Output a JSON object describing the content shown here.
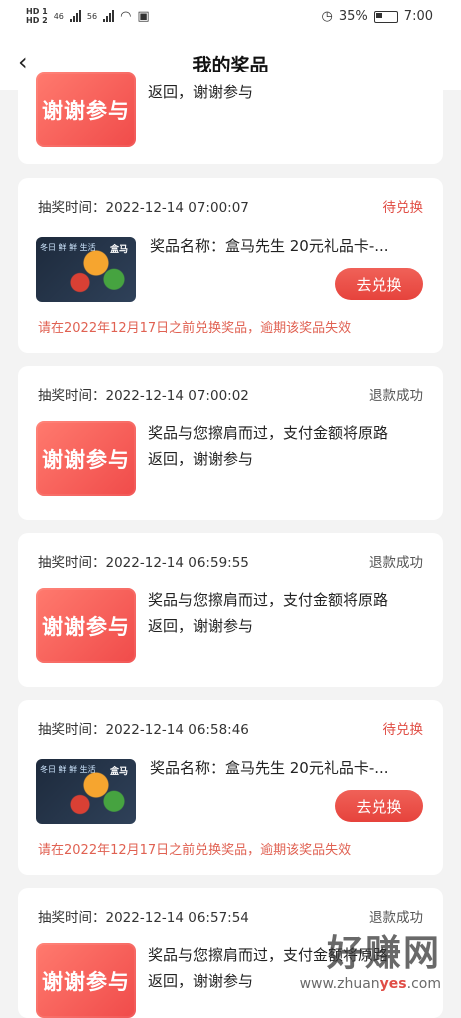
{
  "status_bar": {
    "left_badges": [
      "HD 1",
      "HD 2"
    ],
    "network_labels": [
      "46",
      "56"
    ],
    "battery_percent": "35%",
    "time": "7:00"
  },
  "header": {
    "title": "我的奖品",
    "back_icon": "chevron-left-icon"
  },
  "items": [
    {
      "type": "sorry",
      "text": "返回，谢谢参与",
      "thumb_label": "谢谢参与"
    },
    {
      "type": "gift",
      "time_label": "抽奖时间：",
      "time": "2022-12-14 07:00:07",
      "status": "待兑换",
      "prize": "奖品名称：盒马先生 20元礼品卡-...",
      "button": "去兑换",
      "notice": "请在2022年12月17日之前兑换奖品，逾期该奖品失效",
      "thumb_brand": "盒马",
      "thumb_side": "冬日 鲜 鲜 生活"
    },
    {
      "type": "sorry",
      "time_label": "抽奖时间：",
      "time": "2022-12-14 07:00:02",
      "status": "退款成功",
      "text1": "奖品与您擦肩而过，支付金额将原路",
      "text2": "返回，谢谢参与",
      "thumb_label": "谢谢参与"
    },
    {
      "type": "sorry",
      "time_label": "抽奖时间：",
      "time": "2022-12-14 06:59:55",
      "status": "退款成功",
      "text1": "奖品与您擦肩而过，支付金额将原路",
      "text2": "返回，谢谢参与",
      "thumb_label": "谢谢参与"
    },
    {
      "type": "gift",
      "time_label": "抽奖时间：",
      "time": "2022-12-14 06:58:46",
      "status": "待兑换",
      "prize": "奖品名称：盒马先生 20元礼品卡-...",
      "button": "去兑换",
      "notice": "请在2022年12月17日之前兑换奖品，逾期该奖品失效",
      "thumb_brand": "盒马",
      "thumb_side": "冬日 鲜 鲜 生活"
    },
    {
      "type": "sorry",
      "time_label": "抽奖时间：",
      "time": "2022-12-14 06:57:54",
      "status": "退款成功",
      "text1": "奖品与您擦肩而过，支付金额将原路",
      "text2": "返回，谢谢参与",
      "thumb_label": "谢谢参与"
    }
  ],
  "watermark": {
    "main": "好赚网",
    "url_prefix": "www.zhuan",
    "url_highlight": "yes",
    "url_suffix": ".com"
  },
  "colors": {
    "accent": "#e04e45",
    "button": "#ea4b43",
    "background": "#f3f3f3"
  }
}
